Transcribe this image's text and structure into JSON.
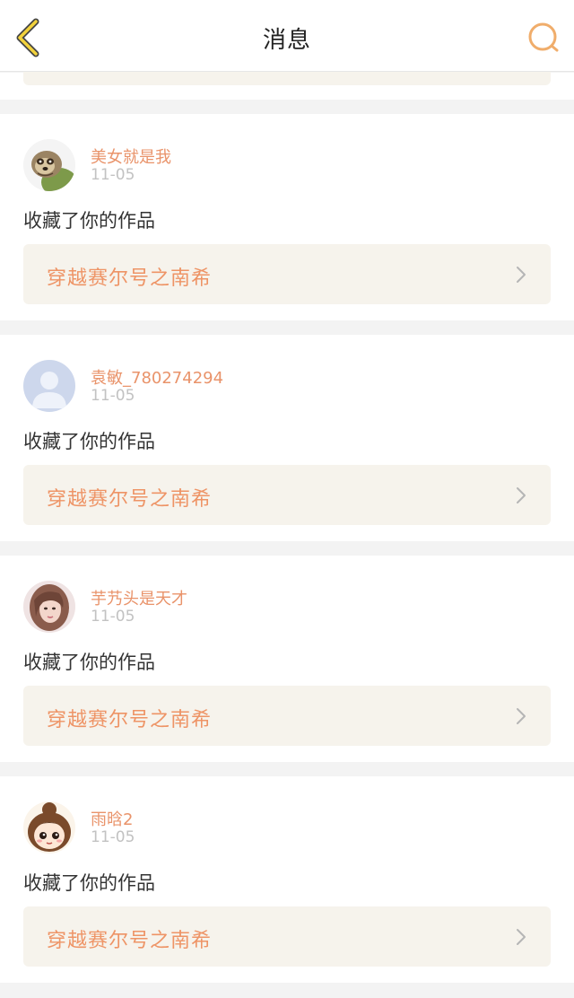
{
  "header": {
    "title": "消息",
    "back_icon": "chevron-left-icon",
    "search_icon": "search-icon",
    "accent": "#f0ad6b"
  },
  "messages": [
    {
      "username": "美女就是我",
      "time": "11-05",
      "action": "收藏了你的作品",
      "work_title": "穿越赛尔号之南希",
      "avatar": "sloth-avatar"
    },
    {
      "username": "袁敏_780274294",
      "time": "11-05",
      "action": "收藏了你的作品",
      "work_title": "穿越赛尔号之南希",
      "avatar": "default-user-avatar"
    },
    {
      "username": "芋艿头是天才",
      "time": "11-05",
      "action": "收藏了你的作品",
      "work_title": "穿越赛尔号之南希",
      "avatar": "girl-photo-avatar"
    },
    {
      "username": "雨晗2",
      "time": "11-05",
      "action": "收藏了你的作品",
      "work_title": "穿越赛尔号之南希",
      "avatar": "cartoon-girl-avatar"
    }
  ],
  "colors": {
    "username": "#e9936a",
    "work_title": "#ee9466",
    "work_box_bg": "#f6f3ec",
    "page_bg": "#f3f3f3"
  }
}
